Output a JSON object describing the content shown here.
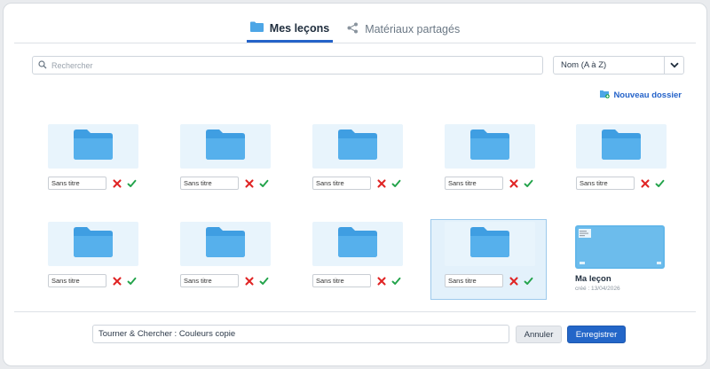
{
  "tabs": [
    {
      "label": "Mes leçons",
      "icon": "folder-icon",
      "active": true
    },
    {
      "label": "Matériaux partagés",
      "icon": "share-icon",
      "active": false
    }
  ],
  "search": {
    "placeholder": "Rechercher",
    "value": ""
  },
  "sort": {
    "selected": "Nom (A à Z)"
  },
  "new_folder": {
    "label": "Nouveau dossier"
  },
  "folders": [
    {
      "name": "Sans titre"
    },
    {
      "name": "Sans titre"
    },
    {
      "name": "Sans titre"
    },
    {
      "name": "Sans titre"
    },
    {
      "name": "Sans titre"
    },
    {
      "name": "Sans titre"
    },
    {
      "name": "Sans titre"
    },
    {
      "name": "Sans titre"
    },
    {
      "name": "Sans titre",
      "selected": true
    }
  ],
  "lesson": {
    "title": "Ma leçon",
    "created": "créé : 13/04/2026"
  },
  "footer": {
    "name_value": "Tourner & Chercher : Couleurs copie",
    "cancel_label": "Annuler",
    "save_label": "Enregistrer"
  },
  "colors": {
    "accent": "#2563c9",
    "folder": "#4da6e6",
    "folder_bg": "#e8f4fc",
    "cancel_x": "#e02424",
    "confirm_check": "#22a34a"
  }
}
